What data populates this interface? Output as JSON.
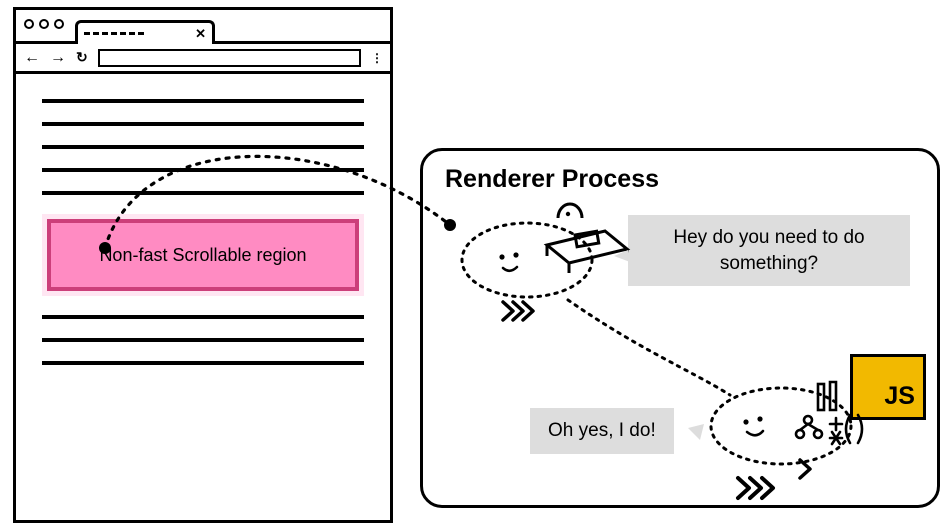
{
  "browser": {
    "nfs_label": "Non-fast Scrollable region"
  },
  "renderer": {
    "title": "Renderer Process",
    "bubble1": "Hey do you need to do something?",
    "bubble2": "Oh yes, I do!"
  },
  "js": {
    "label": "JS"
  }
}
